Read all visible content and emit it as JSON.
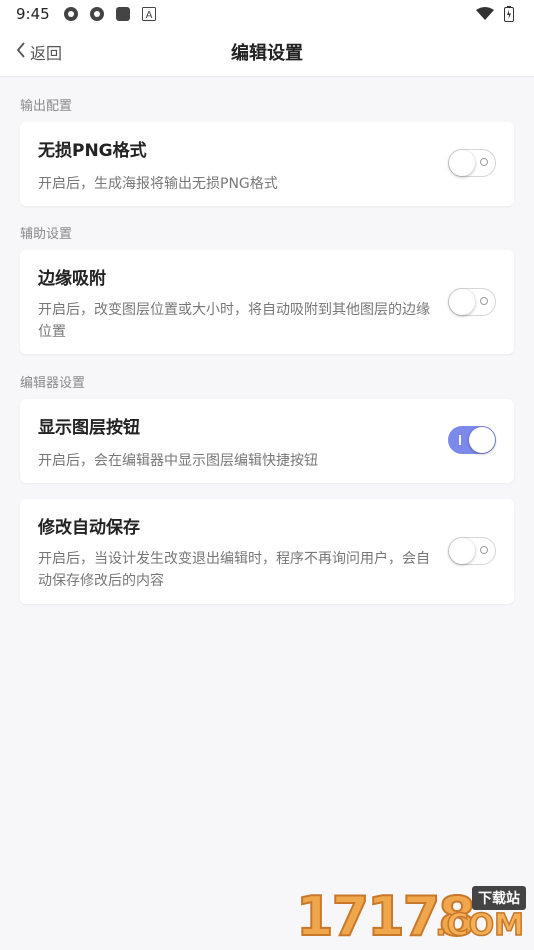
{
  "status_bar": {
    "time": "9:45",
    "icons_left": [
      "gear-like-app-icon",
      "gear-like-app-icon",
      "square-app-icon",
      "a-app-icon"
    ],
    "icons_right": [
      "wifi-icon",
      "battery-icon"
    ]
  },
  "header": {
    "back_label": "返回",
    "title": "编辑设置"
  },
  "sections": [
    {
      "label": "输出配置",
      "items": [
        {
          "title": "无损PNG格式",
          "desc": "开启后，生成海报将输出无损PNG格式",
          "enabled": false
        }
      ]
    },
    {
      "label": "辅助设置",
      "items": [
        {
          "title": "边缘吸附",
          "desc": "开启后，改变图层位置或大小时，将自动吸附到其他图层的边缘位置",
          "enabled": false
        }
      ]
    },
    {
      "label": "编辑器设置",
      "items": [
        {
          "title": "显示图层按钮",
          "desc": "开启后，会在编辑器中显示图层编辑快捷按钮",
          "enabled": true
        },
        {
          "title": "修改自动保存",
          "desc": "开启后，当设计发生改变退出编辑时，程序不再询问用户，会自动保存修改后的内容",
          "enabled": false
        }
      ]
    }
  ],
  "colors": {
    "accent": "#7d89ea",
    "background": "#f7f7f9"
  },
  "watermark": {
    "digits": "17178",
    "tag": "下载站",
    "suffix": ".COM"
  }
}
